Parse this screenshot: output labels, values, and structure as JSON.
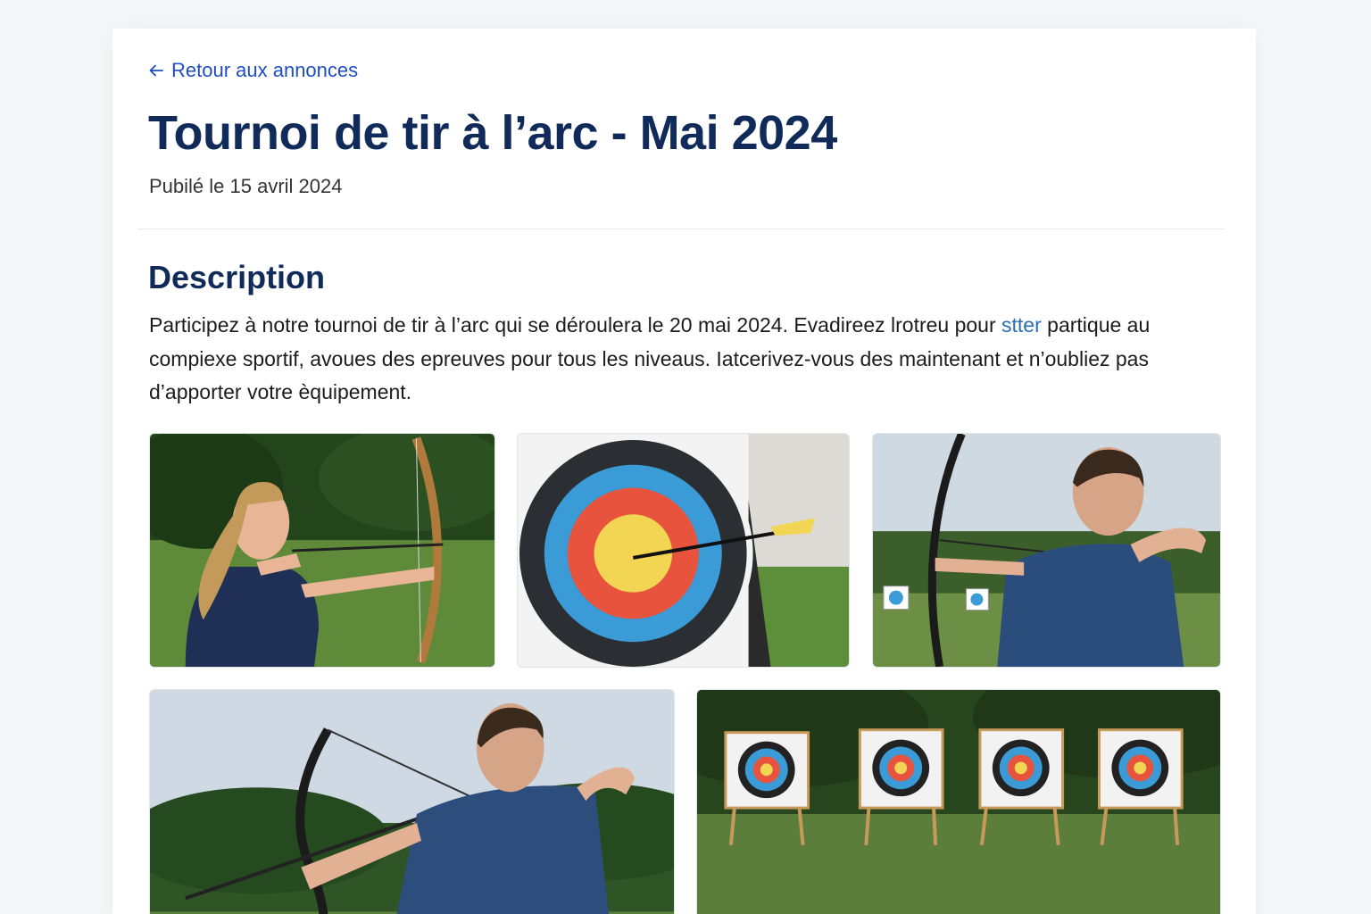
{
  "back_link": {
    "label": "Retour aux annonces",
    "icon": "arrow-left-icon"
  },
  "title": "Tournoi de tir à l’arc - Mai 2024",
  "published": "Pubilé le 15 avril 2024",
  "description": {
    "heading": "Description",
    "text_before_link": "Participez à notre tournoi de tir à l’arc qui se déroulera le 20 mai 2024. Evadireez lrotreu pour ",
    "link_text": "stter",
    "text_after_link": " partique au compiexe sportif, avoues des epreuves pour tous les niveaus. Iatcerivez-vous des maintenant et n’oubliez pas d’apporter votre èquipement."
  },
  "gallery": [
    {
      "subject": "woman-drawing-recurve-bow"
    },
    {
      "subject": "arrow-in-target-closeup"
    },
    {
      "subject": "man-aiming-at-distant-targets"
    },
    {
      "subject": "man-with-compound-bow"
    },
    {
      "subject": "four-targets-on-field"
    }
  ],
  "colors": {
    "link": "#1f4fbf",
    "heading": "#102a5a",
    "page_bg": "#f6f7f8"
  }
}
